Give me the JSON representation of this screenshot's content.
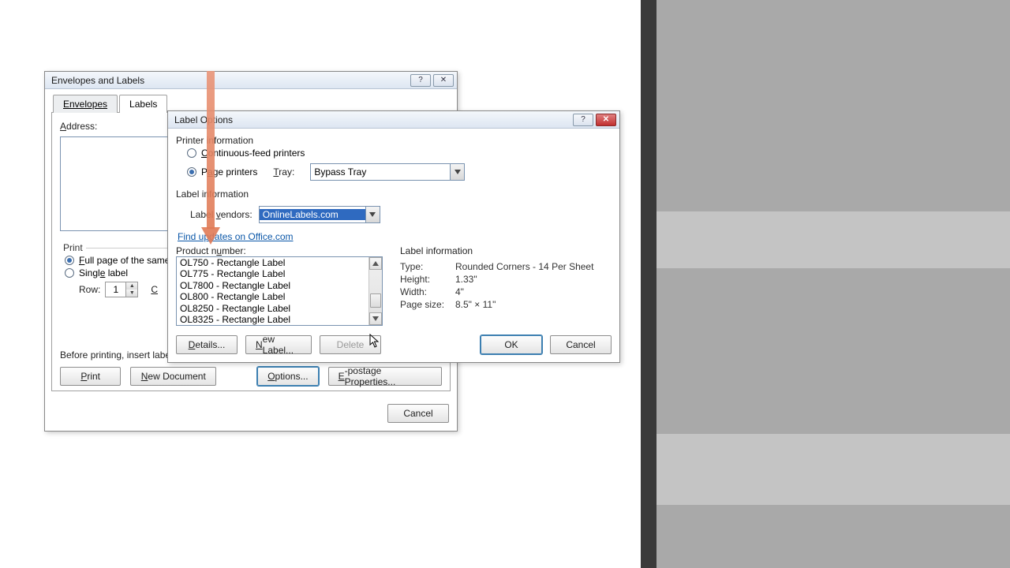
{
  "bg_dialog": {
    "title": "Envelopes and Labels",
    "tabs": {
      "envelopes": "Envelopes",
      "labels": "Labels"
    },
    "address_label": "Address:",
    "print_group": "Print",
    "full_page": "Full page of the same label",
    "single_label": "Single label",
    "row_label": "Row:",
    "row_value": "1",
    "column_label": "Column:",
    "note": "Before printing, insert labels in your printer's manual feeder.",
    "btn_print": "Print",
    "btn_new_doc": "New Document",
    "btn_options": "Options...",
    "btn_epostage": "E-postage Properties...",
    "btn_cancel": "Cancel"
  },
  "dlg": {
    "title": "Label Options",
    "printer_info_group": "Printer information",
    "continuous": "Continuous-feed printers",
    "page_printers": "Page printers",
    "tray_label": "Tray:",
    "tray_value": "Bypass Tray",
    "label_info_group": "Label information",
    "vendors_label": "Label vendors:",
    "vendors_value": "OnlineLabels.com",
    "updates_link": "Find updates on Office.com",
    "product_number_label": "Product number:",
    "products": [
      "OL750 - Rectangle Label",
      "OL775 - Rectangle Label",
      "OL7800 - Rectangle Label",
      "OL800 - Rectangle Label",
      "OL8250 - Rectangle Label",
      "OL8325 - Rectangle Label"
    ],
    "info_header": "Label information",
    "info": {
      "type_k": "Type:",
      "type_v": "Rounded Corners - 14 Per Sheet",
      "height_k": "Height:",
      "height_v": "1.33\"",
      "width_k": "Width:",
      "width_v": "4\"",
      "page_k": "Page size:",
      "page_v": "8.5\" × 11\""
    },
    "btn_details": "Details...",
    "btn_new_label": "New Label...",
    "btn_delete": "Delete",
    "btn_ok": "OK",
    "btn_cancel": "Cancel"
  }
}
